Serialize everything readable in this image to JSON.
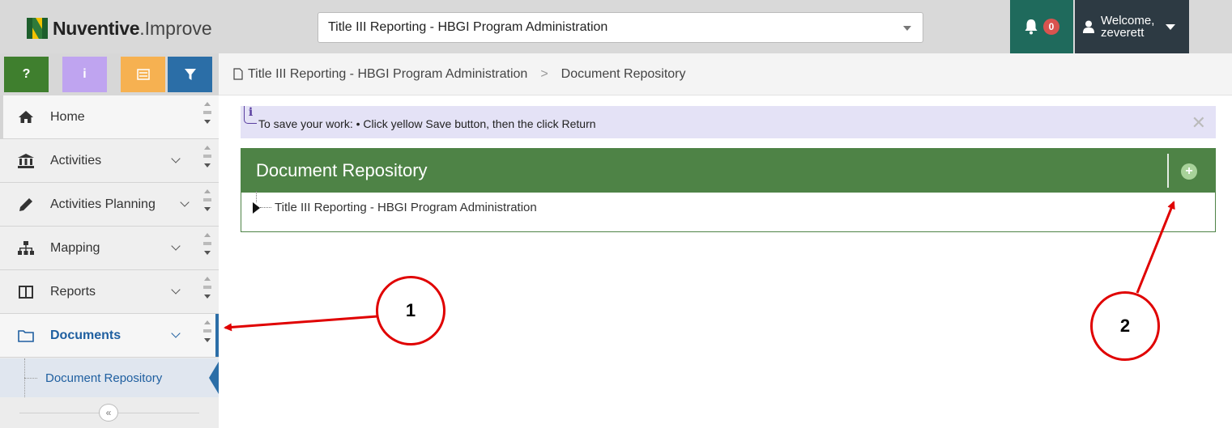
{
  "header": {
    "logo_brand": "Nuventive",
    "logo_dot": ".",
    "logo_product": "Improve",
    "project_selector_value": "Title III Reporting - HBGI Program Administration",
    "notification_count": "0",
    "welcome_line1": "Welcome,",
    "welcome_line2": "zeverett"
  },
  "toolbar": {
    "help_label": "?",
    "info_label": "i"
  },
  "sidebar": {
    "items": [
      {
        "label": "Home"
      },
      {
        "label": "Activities"
      },
      {
        "label": "Activities Planning"
      },
      {
        "label": "Mapping"
      },
      {
        "label": "Reports"
      },
      {
        "label": "Documents"
      }
    ],
    "sub_item": "Document Repository",
    "collapse_label": "«"
  },
  "breadcrumb": {
    "items": [
      "Title III Reporting - HBGI Program Administration",
      "Document Repository"
    ],
    "separator": ">"
  },
  "banner": {
    "icon_letter": "i",
    "message": "To save your work: • Click yellow Save button, then the click Return",
    "close_label": "✕"
  },
  "panel": {
    "title": "Document Repository",
    "add_label": "+",
    "tree_item": "Title III Reporting - HBGI Program Administration"
  },
  "annotations": {
    "first": "1",
    "second": "2"
  },
  "colors": {
    "panel_green": "#4e8346",
    "notif_teal": "#1f6a5c",
    "user_dark": "#2d3a43",
    "active_blue": "#2b6ea7",
    "annotation_red": "#e00000"
  }
}
